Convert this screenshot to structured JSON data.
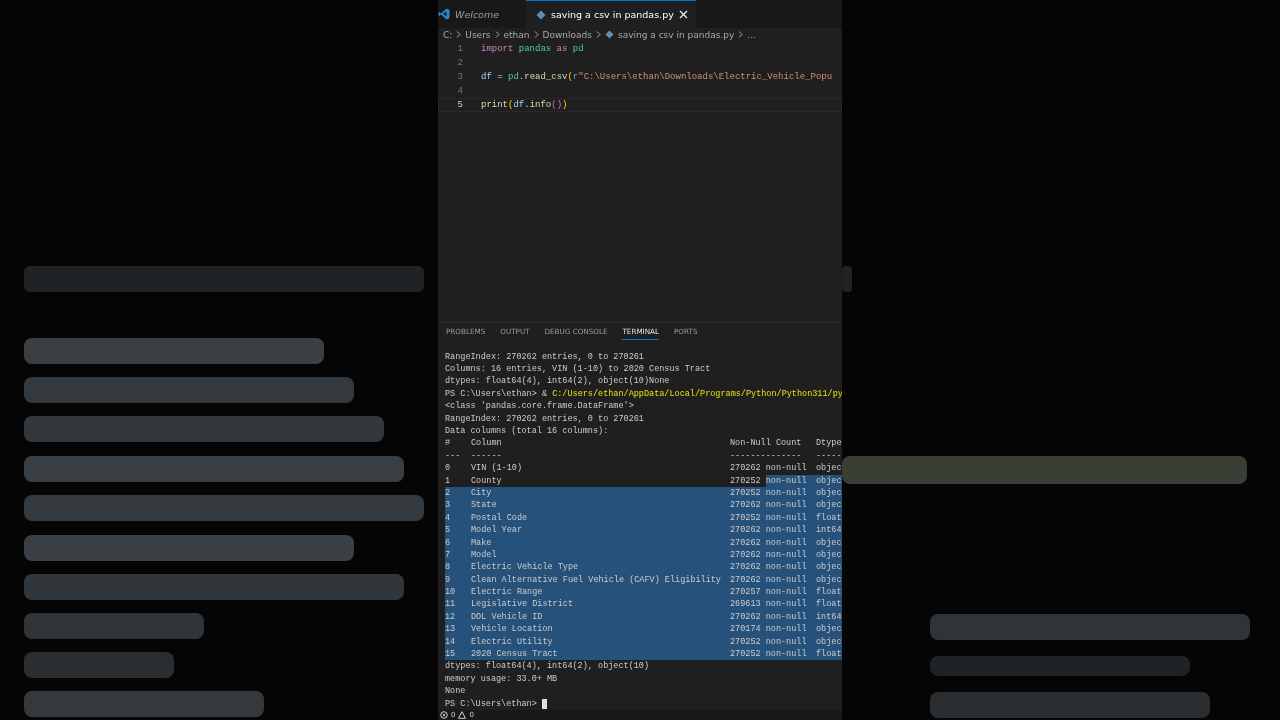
{
  "editor": {
    "tabs": [
      {
        "label": "Welcome",
        "selected": false,
        "preview": true
      },
      {
        "label": "saving a csv in pandas.py",
        "selected": true,
        "preview": false
      }
    ],
    "breadcrumb": [
      {
        "label": "C:",
        "kind": "folder"
      },
      {
        "label": "Users",
        "kind": "folder"
      },
      {
        "label": "ethan",
        "kind": "folder"
      },
      {
        "label": "Downloads",
        "kind": "folder"
      },
      {
        "label": "saving a csv in pandas.py",
        "kind": "file"
      },
      {
        "label": "...",
        "kind": "more"
      }
    ],
    "lines": [
      {
        "number": "1",
        "current": false,
        "tokens": [
          {
            "text": "import",
            "kind": "keyword"
          },
          {
            "text": " pandas",
            "kind": "module"
          },
          {
            "text": " as ",
            "kind": "keyword"
          },
          {
            "text": "pd",
            "kind": "module"
          }
        ]
      },
      {
        "number": "2",
        "current": false
      },
      {
        "number": "3",
        "current": false,
        "tokens": [
          {
            "text": "df",
            "kind": "variable"
          },
          {
            "text": " = ",
            "kind": "plain"
          },
          {
            "text": "pd",
            "kind": "module"
          },
          {
            "text": ".",
            "kind": "plain"
          },
          {
            "text": "read_csv",
            "kind": "function"
          },
          {
            "text": "(",
            "kind": "paren"
          },
          {
            "text": "r",
            "kind": "prefix"
          },
          {
            "text": "\"C:\\Users\\ethan\\Downloads\\Electric_Vehicle_Popu",
            "kind": "string"
          }
        ]
      },
      {
        "number": "4",
        "current": false
      },
      {
        "number": "5",
        "current": true,
        "tokens": [
          {
            "text": "print",
            "kind": "function"
          },
          {
            "text": "(",
            "kind": "paren"
          },
          {
            "text": "df",
            "kind": "variable"
          },
          {
            "text": ".",
            "kind": "plain"
          },
          {
            "text": "info",
            "kind": "function"
          },
          {
            "text": "()",
            "kind": "paren2"
          },
          {
            "text": ")",
            "kind": "paren"
          }
        ]
      }
    ]
  },
  "panel": {
    "tabs": [
      {
        "label": "PROBLEMS",
        "selected": false
      },
      {
        "label": "OUTPUT",
        "selected": false
      },
      {
        "label": "DEBUG CONSOLE",
        "selected": false
      },
      {
        "label": "TERMINAL",
        "selected": true
      },
      {
        "label": "PORTS",
        "selected": false
      }
    ],
    "terminal": [
      {
        "kind": "text",
        "text": "RangeIndex: 270262 entries, 0 to 270261"
      },
      {
        "kind": "text",
        "text": "Columns: 16 entries, VIN (1-10) to 2020 Census Tract"
      },
      {
        "kind": "text",
        "text": "dtypes: float64(4), int64(2), object(10)None"
      },
      {
        "kind": "text",
        "text": "PS C:\\Users\\ethan> & ",
        "path": "C:/Users/ethan/AppData/Local/Programs/Python/Python311/py"
      },
      {
        "kind": "text",
        "text": "<class 'pandas.core.frame.DataFrame'>"
      },
      {
        "kind": "text",
        "text": "RangeIndex: 270262 entries, 0 to 270261"
      },
      {
        "kind": "text",
        "text": "Data columns (total 16 columns):"
      },
      {
        "kind": "row",
        "selected": false,
        "cells": [
          "#",
          "Column",
          "Non-Null Count",
          "Dtype"
        ]
      },
      {
        "kind": "row",
        "selected": false,
        "cells": [
          "---",
          "------",
          "--------------",
          "-----"
        ]
      },
      {
        "kind": "row",
        "selected": false,
        "cells": [
          "0",
          "VIN (1-10)",
          "270262 non-null",
          "objec"
        ]
      },
      {
        "kind": "row",
        "selected": true,
        "partial": true,
        "cells": [
          "1",
          "County",
          "270252 non-null",
          "objec"
        ]
      },
      {
        "kind": "row",
        "selected": true,
        "partial": false,
        "cells": [
          "2",
          "City",
          "270252 non-null",
          "objec"
        ]
      },
      {
        "kind": "row",
        "selected": true,
        "partial": false,
        "cells": [
          "3",
          "State",
          "270262 non-null",
          "objec"
        ]
      },
      {
        "kind": "row",
        "selected": true,
        "partial": false,
        "cells": [
          "4",
          "Postal Code",
          "270252 non-null",
          "float"
        ]
      },
      {
        "kind": "row",
        "selected": true,
        "partial": false,
        "cells": [
          "5",
          "Model Year",
          "270262 non-null",
          "int64"
        ]
      },
      {
        "kind": "row",
        "selected": true,
        "partial": false,
        "cells": [
          "6",
          "Make",
          "270262 non-null",
          "objec"
        ]
      },
      {
        "kind": "row",
        "selected": true,
        "partial": false,
        "cells": [
          "7",
          "Model",
          "270262 non-null",
          "objec"
        ]
      },
      {
        "kind": "row",
        "selected": true,
        "partial": false,
        "cells": [
          "8",
          "Electric Vehicle Type",
          "270262 non-null",
          "objec"
        ]
      },
      {
        "kind": "row",
        "selected": true,
        "partial": false,
        "cells": [
          "9",
          "Clean Alternative Fuel Vehicle (CAFV) Eligibility",
          "270262 non-null",
          "objec"
        ]
      },
      {
        "kind": "row",
        "selected": true,
        "partial": false,
        "cells": [
          "10",
          "Electric Range",
          "270257 non-null",
          "float"
        ]
      },
      {
        "kind": "row",
        "selected": true,
        "partial": false,
        "cells": [
          "11",
          "Legislative District",
          "269613 non-null",
          "float"
        ]
      },
      {
        "kind": "row",
        "selected": true,
        "partial": false,
        "cells": [
          "12",
          "DOL Vehicle ID",
          "270262 non-null",
          "int64"
        ]
      },
      {
        "kind": "row",
        "selected": true,
        "partial": false,
        "cells": [
          "13",
          "Vehicle Location",
          "270174 non-null",
          "objec"
        ]
      },
      {
        "kind": "row",
        "selected": true,
        "partial": false,
        "cells": [
          "14",
          "Electric Utility",
          "270252 non-null",
          "objec"
        ]
      },
      {
        "kind": "row",
        "selected": true,
        "partial": false,
        "cells": [
          "15",
          "2020 Census Tract",
          "270252 non-null",
          "float"
        ]
      },
      {
        "kind": "text",
        "text": "dtypes: float64(4), int64(2), object(10)"
      },
      {
        "kind": "text",
        "text": "memory usage: 33.0+ MB"
      },
      {
        "kind": "text",
        "text": "None"
      },
      {
        "kind": "prompt",
        "text": "PS C:\\Users\\ethan>"
      }
    ]
  },
  "status_bar": {
    "errors": "0",
    "warnings": "0"
  }
}
